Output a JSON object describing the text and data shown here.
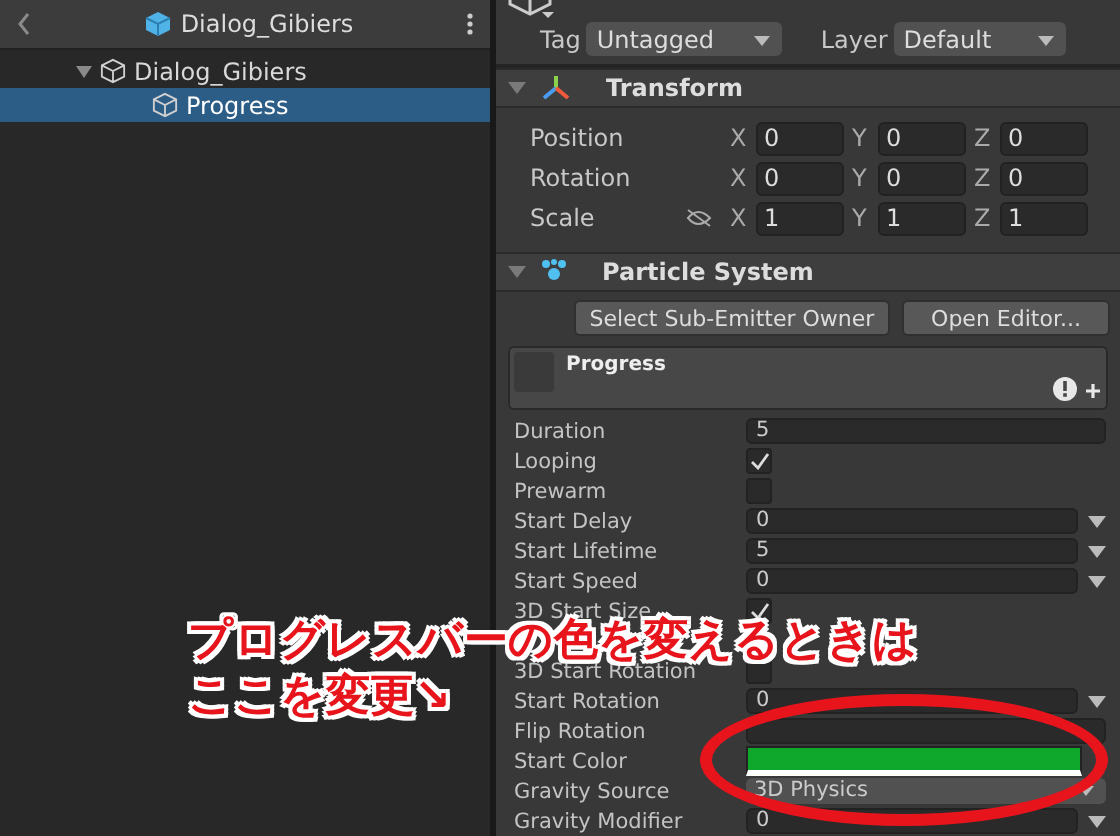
{
  "hierarchy": {
    "scene": "Dialog_Gibiers",
    "items": [
      {
        "label": "Dialog_Gibiers",
        "expanded": true,
        "selected": false,
        "children": [
          {
            "label": "Progress",
            "selected": true
          }
        ]
      }
    ]
  },
  "inspector": {
    "tag_label": "Tag",
    "tag": "Untagged",
    "layer_label": "Layer",
    "layer": "Default",
    "transform": {
      "title": "Transform",
      "expanded": true,
      "rows": [
        {
          "label": "Position",
          "values": [
            {
              "axis": "X",
              "value": "0"
            },
            {
              "axis": "Y",
              "value": "0"
            },
            {
              "axis": "Z",
              "value": "0"
            }
          ]
        },
        {
          "label": "Rotation",
          "values": [
            {
              "axis": "X",
              "value": "0"
            },
            {
              "axis": "Y",
              "value": "0"
            },
            {
              "axis": "Z",
              "value": "0"
            }
          ]
        },
        {
          "label": "Scale",
          "scale_link": true,
          "values": [
            {
              "axis": "X",
              "value": "1"
            },
            {
              "axis": "Y",
              "value": "1"
            },
            {
              "axis": "Z",
              "value": "1"
            }
          ]
        }
      ]
    },
    "particle_system": {
      "title": "Particle System",
      "expanded": true,
      "buttons": [
        "Select Sub-Emitter Owner",
        "Open Editor..."
      ],
      "module": "Progress",
      "rows": [
        {
          "kind": "field",
          "label": "Duration",
          "value": "5"
        },
        {
          "kind": "check",
          "label": "Looping",
          "checked": true
        },
        {
          "kind": "check",
          "label": "Prewarm",
          "checked": false
        },
        {
          "kind": "curve",
          "label": "Start Delay",
          "value": "0"
        },
        {
          "kind": "curve",
          "label": "Start Lifetime",
          "value": "5"
        },
        {
          "kind": "curve",
          "label": "Start Speed",
          "value": "0"
        },
        {
          "kind": "check",
          "label": "3D Start Size",
          "checked": true
        },
        {
          "kind": "hidden"
        },
        {
          "kind": "check",
          "label": "3D Start Rotation",
          "checked": false
        },
        {
          "kind": "curve",
          "label": "Start Rotation",
          "value": "0"
        },
        {
          "kind": "field",
          "label": "Flip Rotation"
        },
        {
          "kind": "color",
          "label": "Start Color",
          "color": "#10a82c"
        },
        {
          "kind": "dropdown",
          "label": "Gravity Source",
          "value": "3D Physics"
        },
        {
          "kind": "curve",
          "label": "Gravity Modifier",
          "value": "0"
        }
      ]
    }
  },
  "annotation": {
    "lines": [
      "プログレスバーの色を変えるときは",
      "ここを変更↘"
    ]
  }
}
